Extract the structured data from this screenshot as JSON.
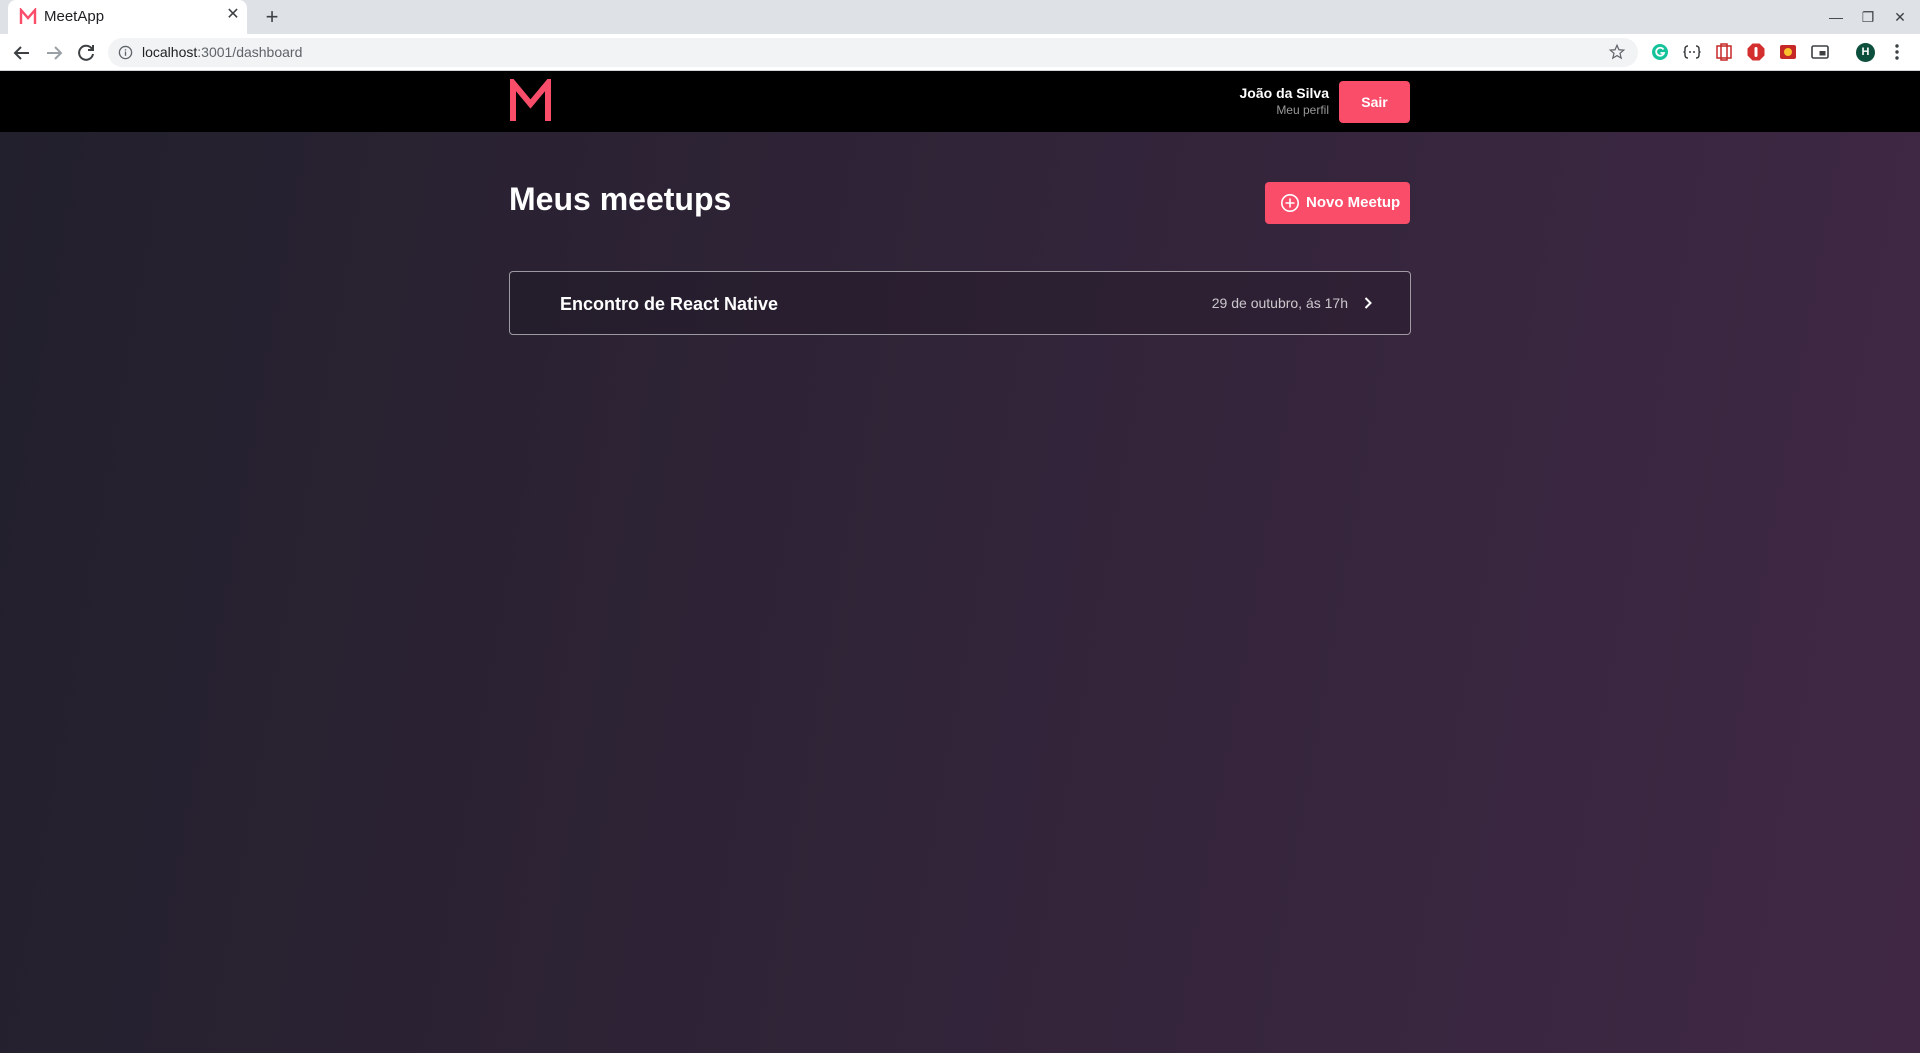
{
  "browser": {
    "tab": {
      "title": "MeetApp",
      "close": "✕"
    },
    "new_tab": "+",
    "window_controls": {
      "minimize": "—",
      "restore": "❐",
      "close": "✕"
    },
    "url": {
      "host": "localhost",
      "path": ":3001/dashboard"
    },
    "profile_initial": "H"
  },
  "colors": {
    "accent": "#f94d6a",
    "header_bg": "#000000",
    "bg_start": "#22202c",
    "bg_end": "#402845"
  },
  "header": {
    "user_name": "João da Silva",
    "profile_link": "Meu perfil",
    "logout_label": "Sair"
  },
  "main": {
    "title": "Meus meetups",
    "new_meetup_label": "Novo Meetup",
    "meetups": [
      {
        "title": "Encontro de React Native",
        "date": "29 de outubro, ás 17h"
      }
    ]
  }
}
